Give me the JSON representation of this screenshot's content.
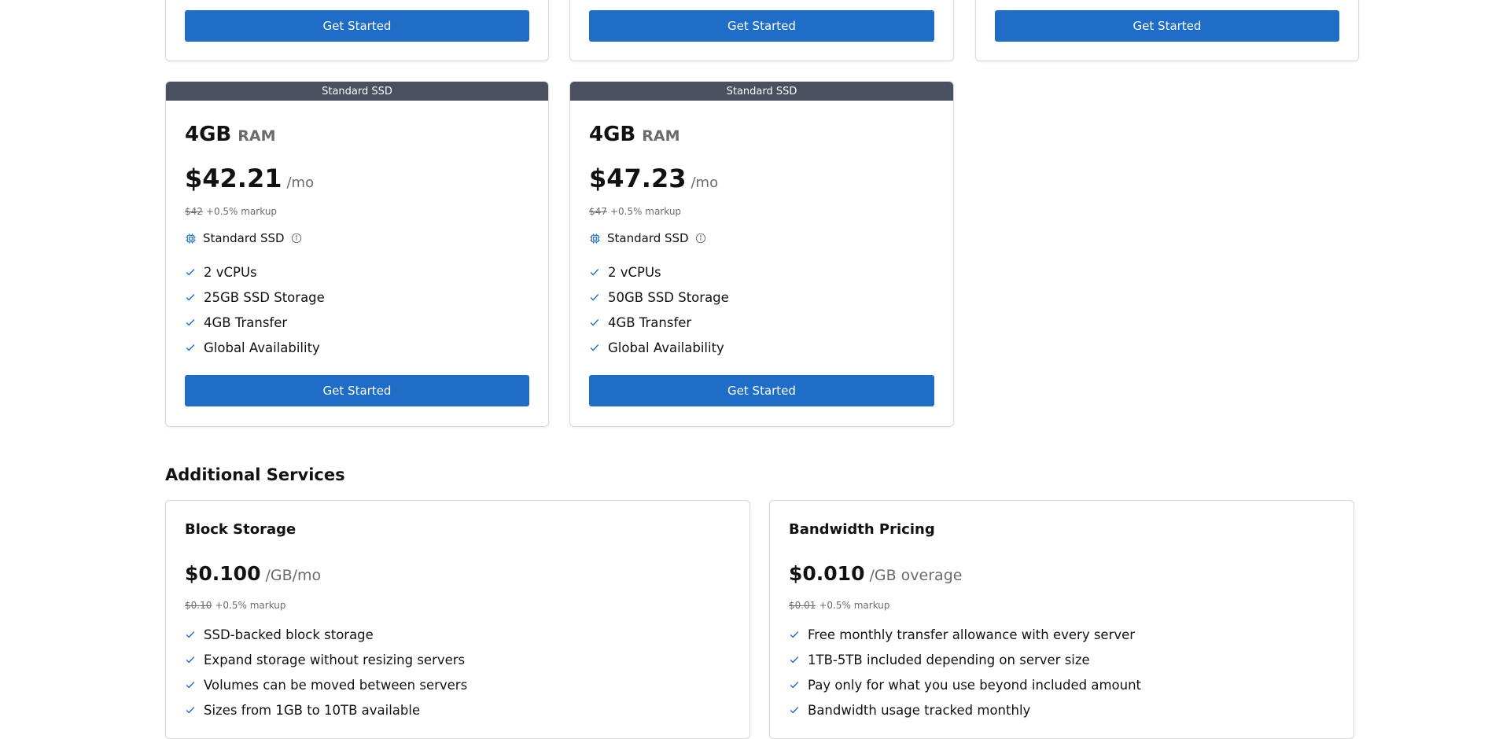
{
  "top_cards": [
    {
      "button_label": "Get Started"
    },
    {
      "button_label": "Get Started"
    },
    {
      "button_label": "Get Started"
    }
  ],
  "plans": [
    {
      "ribbon": "Standard SSD",
      "ram_value": "4GB",
      "ram_unit": "RAM",
      "price": "$42.21",
      "price_period": "/mo",
      "original_price": "$42",
      "markup": "+0.5% markup",
      "storage_type": "Standard SSD",
      "features": [
        "2 vCPUs",
        "25GB SSD Storage",
        "4GB Transfer",
        "Global Availability"
      ],
      "button_label": "Get Started"
    },
    {
      "ribbon": "Standard SSD",
      "ram_value": "4GB",
      "ram_unit": "RAM",
      "price": "$47.23",
      "price_period": "/mo",
      "original_price": "$47",
      "markup": "+0.5% markup",
      "storage_type": "Standard SSD",
      "features": [
        "2 vCPUs",
        "50GB SSD Storage",
        "4GB Transfer",
        "Global Availability"
      ],
      "button_label": "Get Started"
    }
  ],
  "additional_services": {
    "title": "Additional Services",
    "items": [
      {
        "title": "Block Storage",
        "price": "$0.100",
        "price_period": "/GB/mo",
        "original_price": "$0.10",
        "markup": "+0.5% markup",
        "features": [
          "SSD-backed block storage",
          "Expand storage without resizing servers",
          "Volumes can be moved between servers",
          "Sizes from 1GB to 10TB available"
        ]
      },
      {
        "title": "Bandwidth Pricing",
        "price": "$0.010",
        "price_period": "/GB overage",
        "original_price": "$0.01",
        "markup": "+0.5% markup",
        "features": [
          "Free monthly transfer allowance with every server",
          "1TB-5TB included depending on server size",
          "Pay only for what you use beyond included amount",
          "Bandwidth usage tracked monthly"
        ]
      }
    ]
  },
  "colors": {
    "primary_button": "#1f6dc6",
    "ribbon": "#4a5060",
    "muted_text": "#6b6b6b",
    "check": "#1f6dc6"
  },
  "icons": {
    "storage": "chip-icon",
    "info": "info-icon",
    "feature": "check-icon"
  }
}
